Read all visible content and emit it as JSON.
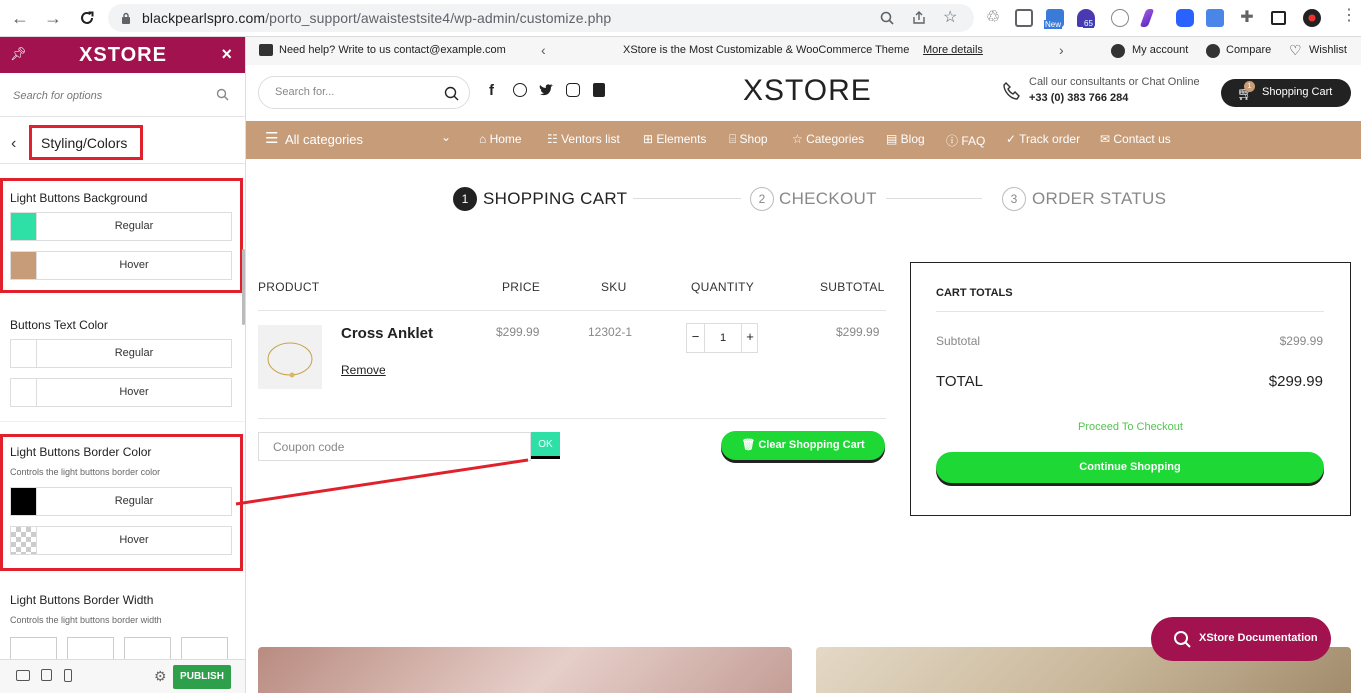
{
  "browser": {
    "url_domain": "blackpearlspro.com",
    "url_path": "/porto_support/awaistestsite4/wp-admin/customize.php",
    "ext_badge_new": "New",
    "ext_badge_count": "65"
  },
  "sidebar": {
    "brand": "XSTORE",
    "search_placeholder": "Search for options",
    "section_title": "Styling/Colors",
    "groups": [
      {
        "label": "Light Buttons Background",
        "desc": "",
        "rows": [
          {
            "label": "Regular",
            "color": "#2ee0a6"
          },
          {
            "label": "Hover",
            "color": "#c69c79"
          }
        ]
      },
      {
        "label": "Buttons Text Color",
        "desc": "",
        "rows": [
          {
            "label": "Regular",
            "color": "#ffffff"
          },
          {
            "label": "Hover",
            "color": "#ffffff"
          }
        ]
      },
      {
        "label": "Light Buttons Border Color",
        "desc": "Controls the light buttons border color",
        "rows": [
          {
            "label": "Regular",
            "color": "#000000"
          },
          {
            "label": "Hover",
            "color": "transparent"
          }
        ]
      },
      {
        "label": "Light Buttons Border Width",
        "desc": "Controls the light buttons border width",
        "rows": []
      }
    ],
    "publish_label": "PUBLISH"
  },
  "site": {
    "topbar": {
      "help": "Need help? Write to us contact@example.com",
      "promo": "XStore is the Most Customizable & WooCommerce Theme",
      "promo_link": "More details",
      "account": "My account",
      "compare": "Compare",
      "wishlist": "Wishlist"
    },
    "header": {
      "search_placeholder": "Search for...",
      "logo": "XSTORE",
      "call_line1": "Call our consultants or Chat Online",
      "call_line2": "+33 (0) 383 766 284",
      "cart_label": "Shopping Cart",
      "cart_count": "1"
    },
    "nav": {
      "all_categories": "All categories",
      "items": [
        "Home",
        "Ventors list",
        "Elements",
        "Shop",
        "Categories",
        "Blog",
        "FAQ",
        "Track order",
        "Contact us"
      ]
    },
    "steps": [
      {
        "num": "1",
        "label": "SHOPPING CART"
      },
      {
        "num": "2",
        "label": "CHECKOUT"
      },
      {
        "num": "3",
        "label": "ORDER STATUS"
      }
    ],
    "cart": {
      "headers": {
        "product": "PRODUCT",
        "price": "PRICE",
        "sku": "SKU",
        "quantity": "QUANTITY",
        "subtotal": "SUBTOTAL"
      },
      "item": {
        "name": "Cross Anklet",
        "remove": "Remove",
        "price": "$299.99",
        "sku": "12302-1",
        "qty_minus": "−",
        "qty": "1",
        "qty_plus": "+",
        "subtotal": "$299.99"
      },
      "coupon_placeholder": "Coupon code",
      "coupon_ok": "OK",
      "clear_label": "Clear Shopping Cart"
    },
    "totals": {
      "title": "CART TOTALS",
      "subtotal_label": "Subtotal",
      "subtotal_value": "$299.99",
      "total_label": "TOTAL",
      "total_value": "$299.99",
      "proceed": "Proceed To Checkout",
      "continue": "Continue Shopping"
    },
    "docs_label": "XStore Documentation"
  },
  "colors": {
    "brand": "#a1124e",
    "nav": "#c69c79",
    "green": "#1ed836",
    "annotation": "#e0202a"
  }
}
